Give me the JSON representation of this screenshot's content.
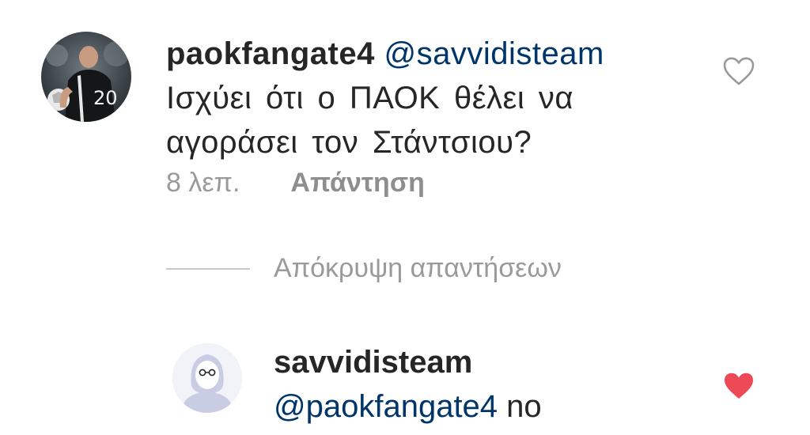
{
  "comment": {
    "username": "paokfangate4",
    "mention": "@savvidisteam",
    "text": "Ισχύει ότι ο ΠΑΟΚ θέλει να αγοράσει τον Στάντσιου?",
    "time": "8 λεπ.",
    "reply_label": "Απάντηση",
    "liked": false
  },
  "hide_replies_label": "Απόκρυψη απαντήσεων",
  "reply": {
    "username": "savvidisteam",
    "mention": "@paokfangate4",
    "text": "no",
    "liked": true
  },
  "icons": {
    "like_empty": "heart-outline-icon",
    "like_filled": "heart-filled-icon"
  },
  "colors": {
    "text": "#262626",
    "mention": "#003569",
    "muted": "#9a9a9a",
    "heart_filled": "#ed4956",
    "heart_outline": "#9a9a9a"
  }
}
